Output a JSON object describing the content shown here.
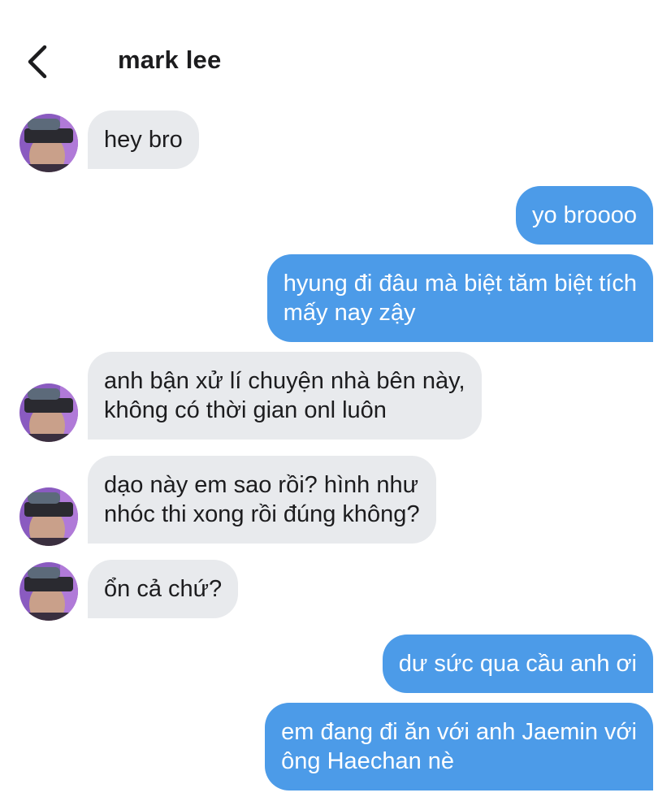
{
  "header": {
    "title": "mark lee"
  },
  "messages": [
    {
      "side": "in",
      "lines": [
        "hey bro"
      ]
    },
    {
      "side": "out",
      "lines": [
        "yo broooo"
      ]
    },
    {
      "side": "out",
      "lines": [
        "hyung đi đâu mà biệt tăm biệt tích",
        "mấy nay zậy"
      ]
    },
    {
      "side": "in",
      "lines": [
        "anh bận xử lí chuyện nhà bên này,",
        "không có thời gian onl luôn"
      ]
    },
    {
      "side": "in",
      "lines": [
        "dạo này em sao rồi? hình như",
        "nhóc thi xong rồi đúng không?"
      ]
    },
    {
      "side": "in",
      "lines": [
        "ổn cả chứ?"
      ]
    },
    {
      "side": "out",
      "lines": [
        "dư sức qua cầu anh ơi"
      ]
    },
    {
      "side": "out",
      "lines": [
        "em đang đi ăn với anh Jaemin với",
        "ông Haechan nè"
      ]
    }
  ],
  "colors": {
    "incoming_bubble": "#e8eaed",
    "outgoing_bubble": "#4c9be8"
  },
  "icons": {
    "back": "chevron-left-icon"
  }
}
